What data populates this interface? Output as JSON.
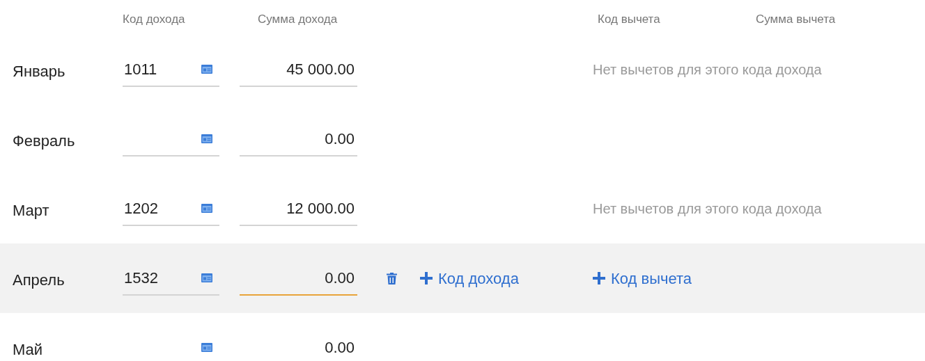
{
  "headers": {
    "income_code": "Код дохода",
    "income_amount": "Сумма дохода",
    "deduction_code": "Код вычета",
    "deduction_amount": "Сумма вычета"
  },
  "rows": [
    {
      "month": "Январь",
      "income_code": "1011",
      "amount": "45 000.00",
      "hovered": false,
      "focused": false,
      "note": "Нет вычетов для этого кода дохода"
    },
    {
      "month": "Февраль",
      "amount": "0.00",
      "hovered": false,
      "focused": false
    },
    {
      "month": "Март",
      "income_code": "1202",
      "amount": "12 000.00",
      "hovered": false,
      "focused": false,
      "note": "Нет вычетов для этого кода дохода"
    },
    {
      "month": "Апрель",
      "income_code": "1532",
      "amount": "0.00",
      "hovered": true,
      "focused": true,
      "add_income": "Код дохода",
      "add_deduction": "Код вычета"
    },
    {
      "month": "Май",
      "amount": "0.00",
      "hovered": false
    }
  ]
}
